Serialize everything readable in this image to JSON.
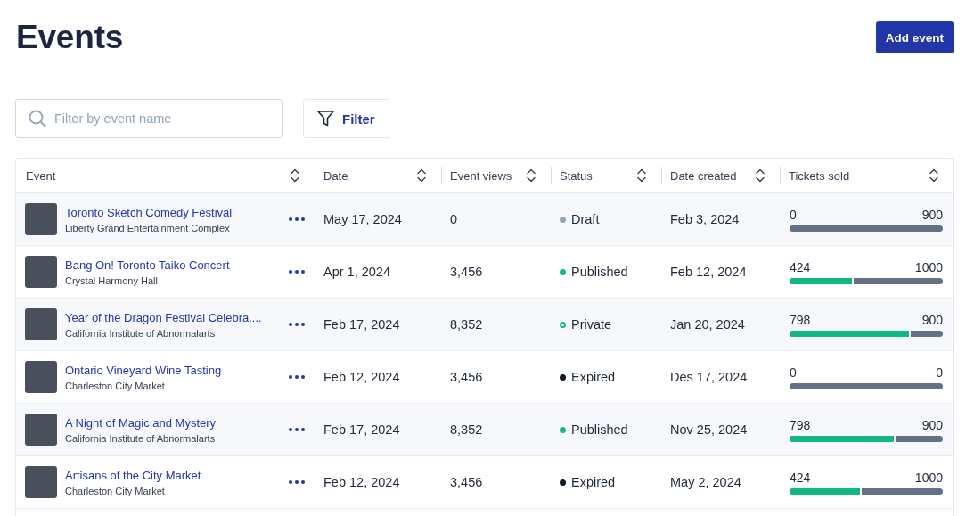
{
  "page": {
    "title": "Events",
    "add_button": "Add event"
  },
  "toolbar": {
    "search": {
      "placeholder": "Filter by event name"
    },
    "filter_button": "Filter"
  },
  "table": {
    "columns": [
      "Event",
      "Date",
      "Event views",
      "Status",
      "Date created",
      "Tickets sold"
    ],
    "rows": [
      {
        "event": "Toronto Sketch Comedy Festival",
        "venue": "Liberty Grand Entertainment Complex",
        "date": "May 17, 2024",
        "views": "0",
        "status": {
          "label": "Draft",
          "color": "#94a3b8",
          "hollow": false
        },
        "created": "Feb 3, 2024",
        "tickets": {
          "sold": "0",
          "capacity": "900",
          "level": 0
        }
      },
      {
        "event": "Bang On! Toronto Taiko Concert",
        "venue": "Crystal Harmony Hall",
        "date": "Apr 1, 2024",
        "views": "3,456",
        "status": {
          "label": "Published",
          "color": "#10b981",
          "hollow": false
        },
        "created": "Feb 12, 2024",
        "tickets": {
          "sold": "424",
          "capacity": "1000",
          "level": 0.42
        }
      },
      {
        "event": "Year of the Dragon Festival Celebra....",
        "venue": "California Institute of Abnormalarts",
        "date": "Feb 17, 2024",
        "views": "8,352",
        "status": {
          "label": "Private",
          "color": "#10b981",
          "hollow": true
        },
        "created": "Jan 20, 2024",
        "tickets": {
          "sold": "798",
          "capacity": "900",
          "level": 0.79
        }
      },
      {
        "event": "Ontario Vineyard Wine Tasting",
        "venue": "Charleston City Market",
        "date": "Feb 12, 2024",
        "views": "3,456",
        "status": {
          "label": "Expired",
          "color": "#0f172a",
          "hollow": false
        },
        "created": "Des 17, 2024",
        "tickets": {
          "sold": "0",
          "capacity": "0",
          "level": 0
        }
      },
      {
        "event": "A Night of Magic and Mystery",
        "venue": "California Institute of Abnormalarts",
        "date": "Feb 17, 2024",
        "views": "8,352",
        "status": {
          "label": "Published",
          "color": "#10b981",
          "hollow": false
        },
        "created": "Nov 25, 2024",
        "tickets": {
          "sold": "798",
          "capacity": "900",
          "level": 0.69
        }
      },
      {
        "event": "Artisans of the City Market",
        "venue": "Charleston City Market",
        "date": "Feb 12, 2024",
        "views": "3,456",
        "status": {
          "label": "Expired",
          "color": "#0f172a",
          "hollow": false
        },
        "created": "May 2, 2024",
        "tickets": {
          "sold": "424",
          "capacity": "1000",
          "level": 0.47
        }
      }
    ]
  }
}
